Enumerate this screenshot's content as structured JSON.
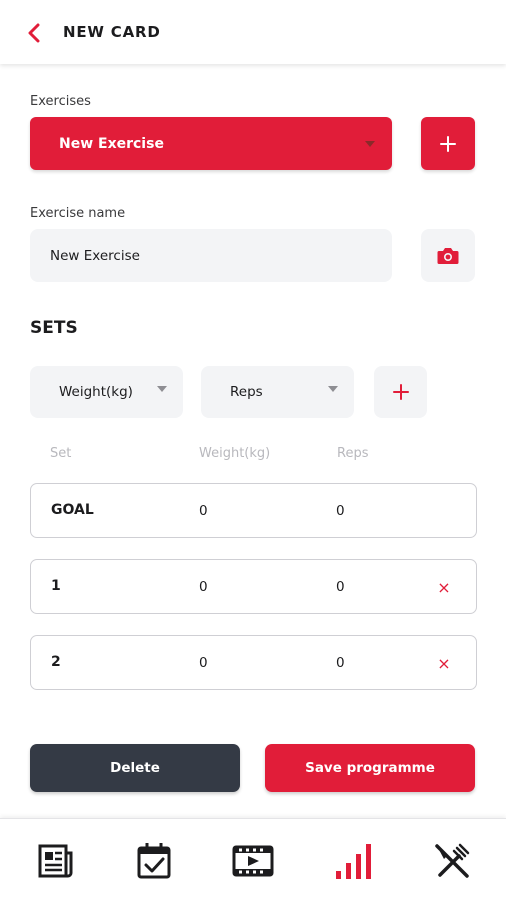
{
  "header": {
    "title": "NEW CARD",
    "back_icon": "chevron-left-icon"
  },
  "exercises": {
    "label": "Exercises",
    "selected": "New Exercise",
    "add_icon": "plus-icon"
  },
  "exercise_name": {
    "label": "Exercise name",
    "value": "New Exercise",
    "camera_icon": "camera-icon"
  },
  "sets": {
    "title": "SETS",
    "column_selectors": [
      "Weight(kg)",
      "Reps"
    ],
    "add_column_icon": "plus-icon",
    "headers": [
      "Set",
      "Weight(kg)",
      "Reps"
    ],
    "rows": [
      {
        "set": "GOAL",
        "weight": "0",
        "reps": "0",
        "removable": false
      },
      {
        "set": "1",
        "weight": "0",
        "reps": "0",
        "removable": true
      },
      {
        "set": "2",
        "weight": "0",
        "reps": "0",
        "removable": true
      }
    ],
    "remove_glyph": "×"
  },
  "actions": {
    "delete_label": "Delete",
    "save_label": "Save programme"
  },
  "bottom_nav": [
    "news-icon",
    "calendar-check-icon",
    "video-icon",
    "stats-bars-icon",
    "restaurant-icon"
  ],
  "colors": {
    "accent": "#e11d39",
    "dark_button": "#343a45",
    "input_bg": "#f3f4f6",
    "text": "#1c1c1e"
  }
}
